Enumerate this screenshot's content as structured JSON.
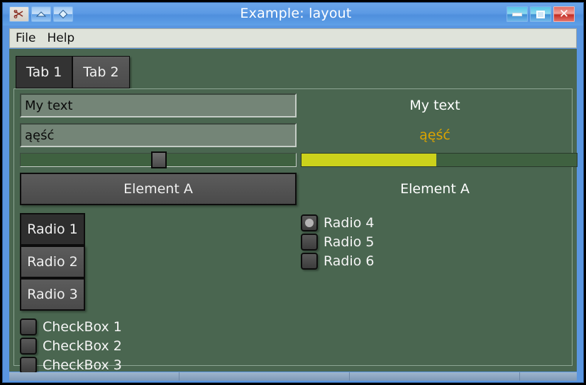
{
  "window": {
    "title": "Example: layout",
    "titlebar_icons": [
      {
        "name": "shade-icon",
        "glyph": "✂"
      },
      {
        "name": "rollup-icon",
        "glyph": "▲"
      },
      {
        "name": "sticky-icon",
        "glyph": "◇"
      }
    ],
    "controls": [
      {
        "name": "minimize-button",
        "label": "–"
      },
      {
        "name": "maximize-button",
        "label": "□"
      },
      {
        "name": "close-button",
        "label": "×"
      }
    ]
  },
  "menubar": {
    "items": [
      {
        "label": "File"
      },
      {
        "label": "Help"
      }
    ]
  },
  "tabs": [
    {
      "label": "Tab 1",
      "selected": true
    },
    {
      "label": "Tab 2",
      "selected": false
    }
  ],
  "left_column": {
    "text_field_1": {
      "value": "My text",
      "placeholder": "My text"
    },
    "text_field_2": {
      "value": "ąęść",
      "placeholder": "ąęść"
    },
    "slider": {
      "value": 50,
      "min": 0,
      "max": 100
    },
    "combo_button": {
      "label": "Element A"
    },
    "radio_buttons": [
      {
        "label": "Radio 1",
        "selected": true
      },
      {
        "label": "Radio 2",
        "selected": false
      },
      {
        "label": "Radio 3",
        "selected": false
      }
    ],
    "checkboxes": [
      {
        "label": "CheckBox 1",
        "checked": false
      },
      {
        "label": "CheckBox 2",
        "checked": false
      },
      {
        "label": "CheckBox 3",
        "checked": false
      }
    ]
  },
  "right_column": {
    "label_1": "My text",
    "label_2": "ąęść",
    "progress": {
      "value": 49,
      "min": 0,
      "max": 100
    },
    "label_3": "Element A",
    "radio_buttons": [
      {
        "label": "Radio 4",
        "selected": true
      },
      {
        "label": "Radio 5",
        "selected": false
      },
      {
        "label": "Radio 6",
        "selected": false
      }
    ]
  },
  "colors": {
    "titlebar": "#5c9ae4",
    "client_background": "#4a6650",
    "accent_text": "#dba400",
    "progress_fill": "#ccd21b",
    "menubar_background": "#dfe3da",
    "statusbar": "#8fa8c4"
  },
  "statusbar": {
    "segments": [
      3,
      3,
      3,
      1
    ]
  }
}
